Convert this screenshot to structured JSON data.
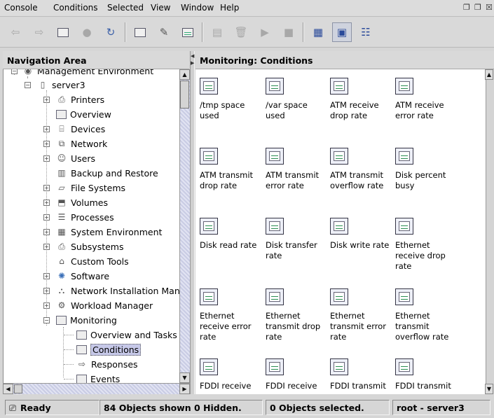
{
  "menu": [
    {
      "label": "Console",
      "underline": "o"
    },
    {
      "label": "Conditions",
      "underline": "C"
    },
    {
      "label": "Selected",
      "underline": "S"
    },
    {
      "label": "View",
      "underline": "V"
    },
    {
      "label": "Window",
      "underline": "W"
    },
    {
      "label": "Help",
      "underline": "H"
    }
  ],
  "menu_display": [
    "Console",
    "Conditions",
    "Selected",
    "View",
    "Window",
    "Help"
  ],
  "toolbar": {
    "icons": [
      "back-arrow-icon",
      "forward-arrow-icon",
      "up-folder-icon",
      "stop-icon",
      "refresh-icon",
      "properties-icon",
      "edit-icon",
      "monitor-icon",
      "copy-icon",
      "delete-icon",
      "play-icon",
      "stop-square-icon",
      "large-icons-view-icon",
      "small-icons-view-icon",
      "details-view-icon"
    ]
  },
  "nav": {
    "title": "Navigation Area",
    "items": [
      {
        "label": "Management Environment",
        "icon": "management-env-icon",
        "level": 0,
        "expander": "−"
      },
      {
        "label": "server3",
        "icon": "server-icon",
        "level": 1,
        "expander": "−"
      },
      {
        "label": "Printers",
        "icon": "printer-icon",
        "level": 2,
        "expander": "+"
      },
      {
        "label": "Overview",
        "icon": "overview-icon",
        "level": 2,
        "expander": ""
      },
      {
        "label": "Devices",
        "icon": "devices-icon",
        "level": 2,
        "expander": "+"
      },
      {
        "label": "Network",
        "icon": "network-icon",
        "level": 2,
        "expander": "+"
      },
      {
        "label": "Users",
        "icon": "users-icon",
        "level": 2,
        "expander": "+"
      },
      {
        "label": "Backup and Restore",
        "icon": "backup-icon",
        "level": 2,
        "expander": ""
      },
      {
        "label": "File Systems",
        "icon": "file-systems-icon",
        "level": 2,
        "expander": "+"
      },
      {
        "label": "Volumes",
        "icon": "volumes-icon",
        "level": 2,
        "expander": "+"
      },
      {
        "label": "Processes",
        "icon": "processes-icon",
        "level": 2,
        "expander": "+"
      },
      {
        "label": "System Environment",
        "icon": "system-env-icon",
        "level": 2,
        "expander": "+"
      },
      {
        "label": "Subsystems",
        "icon": "subsystems-icon",
        "level": 2,
        "expander": "+"
      },
      {
        "label": "Custom Tools",
        "icon": "custom-tools-icon",
        "level": 2,
        "expander": ""
      },
      {
        "label": "Software",
        "icon": "software-icon",
        "level": 2,
        "expander": "+"
      },
      {
        "label": "Network Installation Manag",
        "icon": "nim-icon",
        "level": 2,
        "expander": "+"
      },
      {
        "label": "Workload Manager",
        "icon": "workload-icon",
        "level": 2,
        "expander": "+"
      },
      {
        "label": "Monitoring",
        "icon": "monitoring-icon",
        "level": 2,
        "expander": "−"
      },
      {
        "label": "Overview and Tasks",
        "icon": "overview-icon",
        "level": 3,
        "expander": ""
      },
      {
        "label": "Conditions",
        "icon": "conditions-icon",
        "level": 3,
        "expander": "",
        "selected": true
      },
      {
        "label": "Responses",
        "icon": "responses-icon",
        "level": 3,
        "expander": ""
      },
      {
        "label": "Events",
        "icon": "events-icon",
        "level": 3,
        "expander": ""
      }
    ]
  },
  "main": {
    "title": "Monitoring: Conditions",
    "conditions": [
      "/tmp space used",
      "/var space used",
      "ATM receive drop rate",
      "ATM receive error rate",
      "ATM transmit drop rate",
      "ATM transmit error rate",
      "ATM transmit overflow rate",
      "Disk percent busy",
      "Disk read rate",
      "Disk transfer rate",
      "Disk write rate",
      "Ethernet receive drop rate",
      "Ethernet receive error rate",
      "Ethernet transmit drop rate",
      "Ethernet transmit error rate",
      "Ethernet transmit overflow rate",
      "FDDI receive",
      "FDDI receive",
      "FDDI transmit",
      "FDDI transmit"
    ]
  },
  "status": {
    "ready": "Ready",
    "objects_shown": "84 Objects shown 0 Hidden.",
    "objects_selected": "0 Objects selected.",
    "user_host": "root - server3"
  }
}
